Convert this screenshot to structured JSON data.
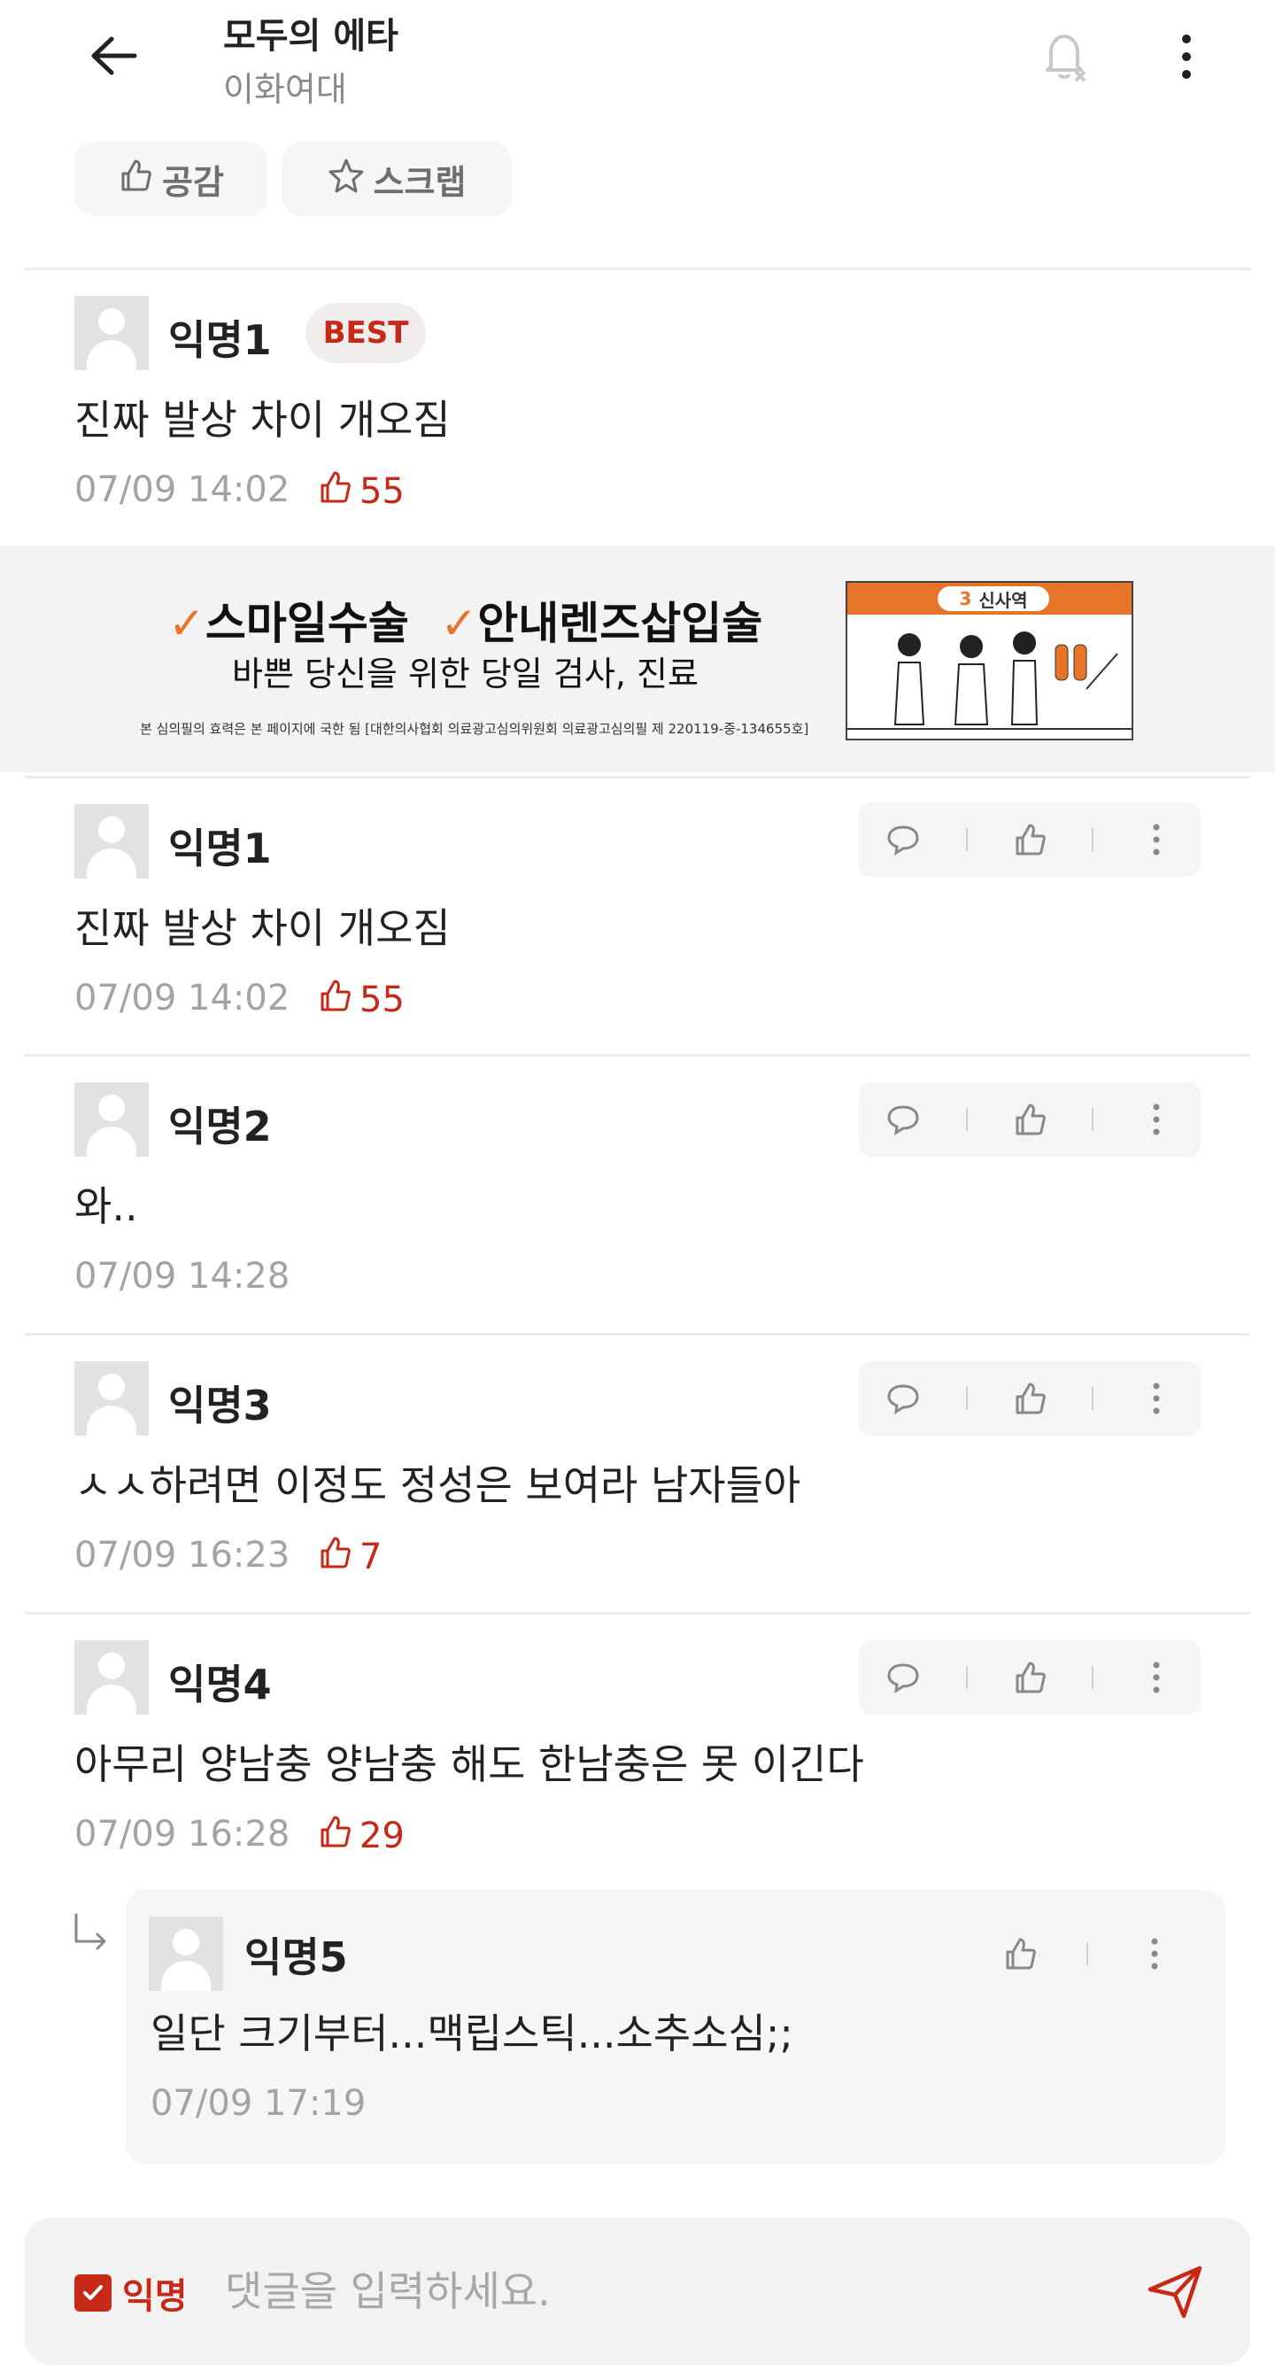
{
  "header": {
    "title": "모두의 에타",
    "subtitle": "이화여대"
  },
  "post_actions": {
    "like_label": "공감",
    "scrap_label": "스크랩"
  },
  "best_comment": {
    "author": "익명1",
    "badge": "BEST",
    "text": "진짜 발상 차이 개오짐",
    "time": "07/09 14:02",
    "likes": "55"
  },
  "ad": {
    "line1_a": "스마일수술",
    "line1_b": "안내렌즈삽입술",
    "check": "✓",
    "line2": "바쁜 당신을 위한 당일 검사, 진료",
    "line3": "본 심의필의 효력은 본 페이지에 국한 됨 [대한의사협회 의료광고심의위원회 의료광고심의필 제 220119-중-134655호]",
    "station": "신사역",
    "station_num": "3"
  },
  "comments": [
    {
      "author": "익명1",
      "text": "진짜 발상 차이 개오짐",
      "time": "07/09 14:02",
      "likes": "55"
    },
    {
      "author": "익명2",
      "text": "와..",
      "time": "07/09 14:28",
      "likes": ""
    },
    {
      "author": "익명3",
      "text": "ㅅㅅ하려면 이정도 정성은 보여라 남자들아",
      "time": "07/09 16:23",
      "likes": "7"
    },
    {
      "author": "익명4",
      "text": "아무리 양남충 양남충 해도 한남충은 못 이긴다",
      "time": "07/09 16:28",
      "likes": "29"
    }
  ],
  "reply": {
    "author": "익명5",
    "text": "일단 크기부터...맥립스틱...소추소심;;",
    "time": "07/09 17:19"
  },
  "input": {
    "anon_label": "익명",
    "placeholder": "댓글을 입력하세요."
  },
  "colors": {
    "accent": "#c62917",
    "muted": "#a3a3a3",
    "button_bg": "#f5f5f5"
  }
}
